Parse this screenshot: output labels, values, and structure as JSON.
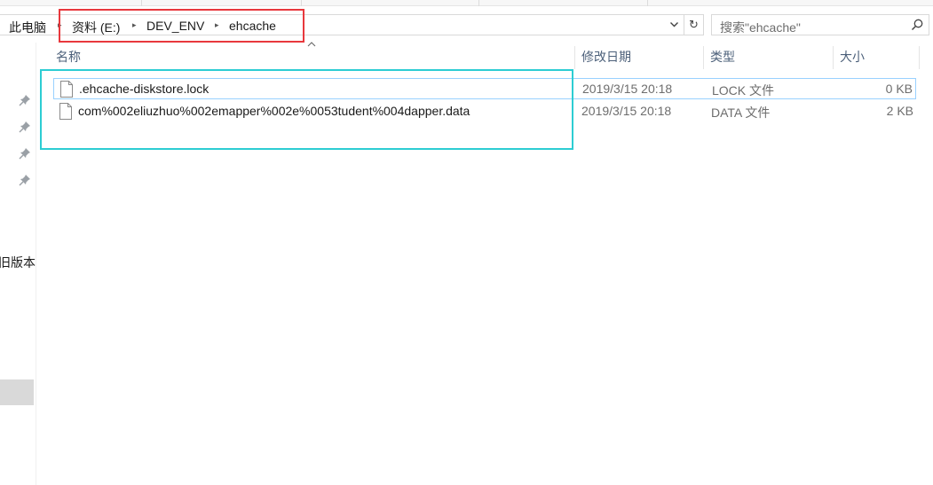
{
  "breadcrumb": {
    "items": [
      "此电脑",
      "资料 (E:)",
      "DEV_ENV",
      "ehcache"
    ]
  },
  "search": {
    "placeholder": "搜索\"ehcache\""
  },
  "nav": {
    "partial_label": "旧版本"
  },
  "columns": {
    "name": "名称",
    "date": "修改日期",
    "type": "类型",
    "size": "大小"
  },
  "files": [
    {
      "name": ".ehcache-diskstore.lock",
      "date": "2019/3/15 20:18",
      "type": "LOCK 文件",
      "size": "0 KB"
    },
    {
      "name": "com%002eliuzhuo%002emapper%002e%0053tudent%004dapper.data",
      "date": "2019/3/15 20:18",
      "type": "DATA 文件",
      "size": "2 KB"
    }
  ],
  "colors": {
    "annotation_red": "#e8383d",
    "annotation_cyan": "#2dcdd3",
    "header_text": "#4c607a"
  },
  "icons": {
    "address_dropdown": "chevron-down-icon",
    "refresh": "refresh-icon",
    "search": "search-icon",
    "pin": "pin-icon",
    "file": "file-icon",
    "sort": "sort-up-icon"
  }
}
